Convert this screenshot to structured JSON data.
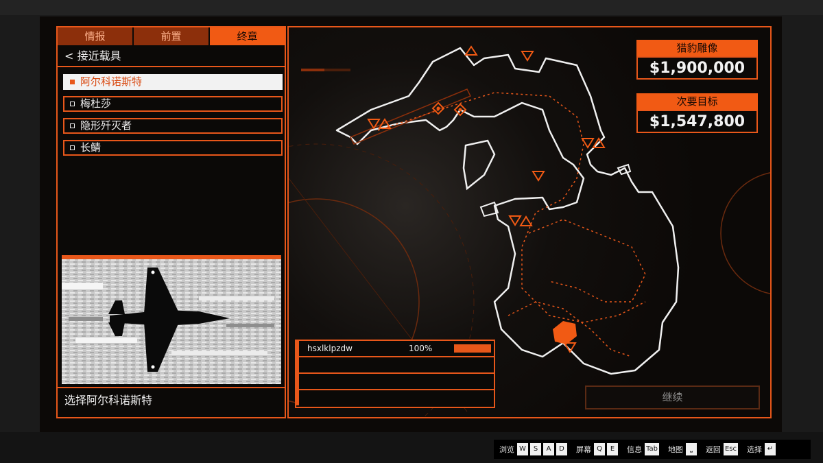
{
  "tabs": [
    {
      "label": "情报"
    },
    {
      "label": "前置"
    },
    {
      "label": "终章"
    }
  ],
  "back_label": "< 接近载具",
  "vehicles": [
    {
      "label": "阿尔科诺斯特",
      "selected": true
    },
    {
      "label": "梅杜莎",
      "selected": false
    },
    {
      "label": "隐形歼灭者",
      "selected": false
    },
    {
      "label": "长鲭",
      "selected": false
    }
  ],
  "select_caption": "选择阿尔科诺斯特",
  "rewards": [
    {
      "label": "猎豹雕像",
      "value": "$1,900,000"
    },
    {
      "label": "次要目标",
      "value": "$1,547,800"
    }
  ],
  "player_rows": [
    {
      "name": "hsxlklpzdw",
      "percent": "100%",
      "progress": 1.0
    },
    {
      "name": "",
      "percent": "",
      "progress": 0
    },
    {
      "name": "",
      "percent": "",
      "progress": 0
    },
    {
      "name": "",
      "percent": "",
      "progress": 0
    }
  ],
  "continue_label": "继续",
  "hints": [
    {
      "label": "浏览",
      "keys": [
        "W",
        "S",
        "A",
        "D"
      ]
    },
    {
      "label": "屏幕",
      "keys": [
        "Q",
        "E"
      ]
    },
    {
      "label": "信息",
      "keys": [
        "Tab"
      ]
    },
    {
      "label": "地图",
      "keys": [
        "⎵"
      ]
    },
    {
      "label": "返回",
      "keys": [
        "Esc"
      ]
    },
    {
      "label": "选择",
      "keys": [
        "↵"
      ]
    }
  ],
  "colors": {
    "accent": "#f15a14",
    "accent_dark": "#8c2f0b",
    "panel_bg": "#0b0907"
  },
  "icons": [
    "target-triangle-icon",
    "target-diamond-icon",
    "aircraft-silhouette-icon",
    "checkbox-icon"
  ]
}
